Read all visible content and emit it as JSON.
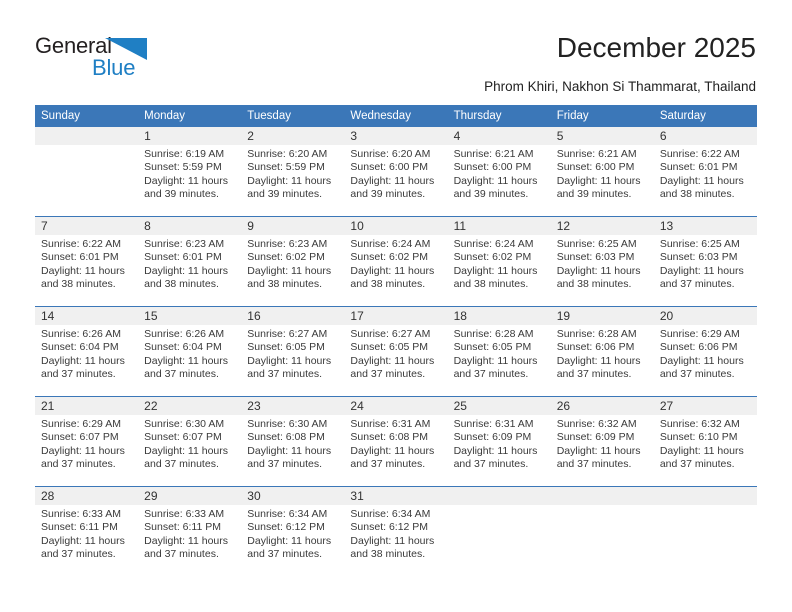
{
  "logo": {
    "text_primary": "General",
    "text_secondary": "Blue",
    "triangle_icon": "triangle-icon",
    "primary_color": "#231f20",
    "secondary_color": "#1f7fc4"
  },
  "header": {
    "title": "December 2025",
    "subtitle": "Phrom Khiri, Nakhon Si Thammarat, Thailand"
  },
  "theme": {
    "header_blue": "#3b77b8",
    "daynum_band": "#f0f0f0",
    "text": "#3a3a3a"
  },
  "calendar": {
    "weekday_headers": [
      "Sunday",
      "Monday",
      "Tuesday",
      "Wednesday",
      "Thursday",
      "Friday",
      "Saturday"
    ],
    "labels": {
      "sunrise": "Sunrise:",
      "sunset": "Sunset:",
      "daylight": "Daylight:"
    },
    "weeks": [
      [
        {
          "day": "",
          "empty": true
        },
        {
          "day": "1",
          "sunrise": "Sunrise: 6:19 AM",
          "sunset": "Sunset: 5:59 PM",
          "daylight_line1": "Daylight: 11 hours",
          "daylight_line2": "and 39 minutes."
        },
        {
          "day": "2",
          "sunrise": "Sunrise: 6:20 AM",
          "sunset": "Sunset: 5:59 PM",
          "daylight_line1": "Daylight: 11 hours",
          "daylight_line2": "and 39 minutes."
        },
        {
          "day": "3",
          "sunrise": "Sunrise: 6:20 AM",
          "sunset": "Sunset: 6:00 PM",
          "daylight_line1": "Daylight: 11 hours",
          "daylight_line2": "and 39 minutes."
        },
        {
          "day": "4",
          "sunrise": "Sunrise: 6:21 AM",
          "sunset": "Sunset: 6:00 PM",
          "daylight_line1": "Daylight: 11 hours",
          "daylight_line2": "and 39 minutes."
        },
        {
          "day": "5",
          "sunrise": "Sunrise: 6:21 AM",
          "sunset": "Sunset: 6:00 PM",
          "daylight_line1": "Daylight: 11 hours",
          "daylight_line2": "and 39 minutes."
        },
        {
          "day": "6",
          "sunrise": "Sunrise: 6:22 AM",
          "sunset": "Sunset: 6:01 PM",
          "daylight_line1": "Daylight: 11 hours",
          "daylight_line2": "and 38 minutes."
        }
      ],
      [
        {
          "day": "7",
          "sunrise": "Sunrise: 6:22 AM",
          "sunset": "Sunset: 6:01 PM",
          "daylight_line1": "Daylight: 11 hours",
          "daylight_line2": "and 38 minutes."
        },
        {
          "day": "8",
          "sunrise": "Sunrise: 6:23 AM",
          "sunset": "Sunset: 6:01 PM",
          "daylight_line1": "Daylight: 11 hours",
          "daylight_line2": "and 38 minutes."
        },
        {
          "day": "9",
          "sunrise": "Sunrise: 6:23 AM",
          "sunset": "Sunset: 6:02 PM",
          "daylight_line1": "Daylight: 11 hours",
          "daylight_line2": "and 38 minutes."
        },
        {
          "day": "10",
          "sunrise": "Sunrise: 6:24 AM",
          "sunset": "Sunset: 6:02 PM",
          "daylight_line1": "Daylight: 11 hours",
          "daylight_line2": "and 38 minutes."
        },
        {
          "day": "11",
          "sunrise": "Sunrise: 6:24 AM",
          "sunset": "Sunset: 6:02 PM",
          "daylight_line1": "Daylight: 11 hours",
          "daylight_line2": "and 38 minutes."
        },
        {
          "day": "12",
          "sunrise": "Sunrise: 6:25 AM",
          "sunset": "Sunset: 6:03 PM",
          "daylight_line1": "Daylight: 11 hours",
          "daylight_line2": "and 38 minutes."
        },
        {
          "day": "13",
          "sunrise": "Sunrise: 6:25 AM",
          "sunset": "Sunset: 6:03 PM",
          "daylight_line1": "Daylight: 11 hours",
          "daylight_line2": "and 37 minutes."
        }
      ],
      [
        {
          "day": "14",
          "sunrise": "Sunrise: 6:26 AM",
          "sunset": "Sunset: 6:04 PM",
          "daylight_line1": "Daylight: 11 hours",
          "daylight_line2": "and 37 minutes."
        },
        {
          "day": "15",
          "sunrise": "Sunrise: 6:26 AM",
          "sunset": "Sunset: 6:04 PM",
          "daylight_line1": "Daylight: 11 hours",
          "daylight_line2": "and 37 minutes."
        },
        {
          "day": "16",
          "sunrise": "Sunrise: 6:27 AM",
          "sunset": "Sunset: 6:05 PM",
          "daylight_line1": "Daylight: 11 hours",
          "daylight_line2": "and 37 minutes."
        },
        {
          "day": "17",
          "sunrise": "Sunrise: 6:27 AM",
          "sunset": "Sunset: 6:05 PM",
          "daylight_line1": "Daylight: 11 hours",
          "daylight_line2": "and 37 minutes."
        },
        {
          "day": "18",
          "sunrise": "Sunrise: 6:28 AM",
          "sunset": "Sunset: 6:05 PM",
          "daylight_line1": "Daylight: 11 hours",
          "daylight_line2": "and 37 minutes."
        },
        {
          "day": "19",
          "sunrise": "Sunrise: 6:28 AM",
          "sunset": "Sunset: 6:06 PM",
          "daylight_line1": "Daylight: 11 hours",
          "daylight_line2": "and 37 minutes."
        },
        {
          "day": "20",
          "sunrise": "Sunrise: 6:29 AM",
          "sunset": "Sunset: 6:06 PM",
          "daylight_line1": "Daylight: 11 hours",
          "daylight_line2": "and 37 minutes."
        }
      ],
      [
        {
          "day": "21",
          "sunrise": "Sunrise: 6:29 AM",
          "sunset": "Sunset: 6:07 PM",
          "daylight_line1": "Daylight: 11 hours",
          "daylight_line2": "and 37 minutes."
        },
        {
          "day": "22",
          "sunrise": "Sunrise: 6:30 AM",
          "sunset": "Sunset: 6:07 PM",
          "daylight_line1": "Daylight: 11 hours",
          "daylight_line2": "and 37 minutes."
        },
        {
          "day": "23",
          "sunrise": "Sunrise: 6:30 AM",
          "sunset": "Sunset: 6:08 PM",
          "daylight_line1": "Daylight: 11 hours",
          "daylight_line2": "and 37 minutes."
        },
        {
          "day": "24",
          "sunrise": "Sunrise: 6:31 AM",
          "sunset": "Sunset: 6:08 PM",
          "daylight_line1": "Daylight: 11 hours",
          "daylight_line2": "and 37 minutes."
        },
        {
          "day": "25",
          "sunrise": "Sunrise: 6:31 AM",
          "sunset": "Sunset: 6:09 PM",
          "daylight_line1": "Daylight: 11 hours",
          "daylight_line2": "and 37 minutes."
        },
        {
          "day": "26",
          "sunrise": "Sunrise: 6:32 AM",
          "sunset": "Sunset: 6:09 PM",
          "daylight_line1": "Daylight: 11 hours",
          "daylight_line2": "and 37 minutes."
        },
        {
          "day": "27",
          "sunrise": "Sunrise: 6:32 AM",
          "sunset": "Sunset: 6:10 PM",
          "daylight_line1": "Daylight: 11 hours",
          "daylight_line2": "and 37 minutes."
        }
      ],
      [
        {
          "day": "28",
          "sunrise": "Sunrise: 6:33 AM",
          "sunset": "Sunset: 6:11 PM",
          "daylight_line1": "Daylight: 11 hours",
          "daylight_line2": "and 37 minutes."
        },
        {
          "day": "29",
          "sunrise": "Sunrise: 6:33 AM",
          "sunset": "Sunset: 6:11 PM",
          "daylight_line1": "Daylight: 11 hours",
          "daylight_line2": "and 37 minutes."
        },
        {
          "day": "30",
          "sunrise": "Sunrise: 6:34 AM",
          "sunset": "Sunset: 6:12 PM",
          "daylight_line1": "Daylight: 11 hours",
          "daylight_line2": "and 37 minutes."
        },
        {
          "day": "31",
          "sunrise": "Sunrise: 6:34 AM",
          "sunset": "Sunset: 6:12 PM",
          "daylight_line1": "Daylight: 11 hours",
          "daylight_line2": "and 38 minutes."
        },
        {
          "day": "",
          "empty": true
        },
        {
          "day": "",
          "empty": true
        },
        {
          "day": "",
          "empty": true
        }
      ]
    ]
  }
}
